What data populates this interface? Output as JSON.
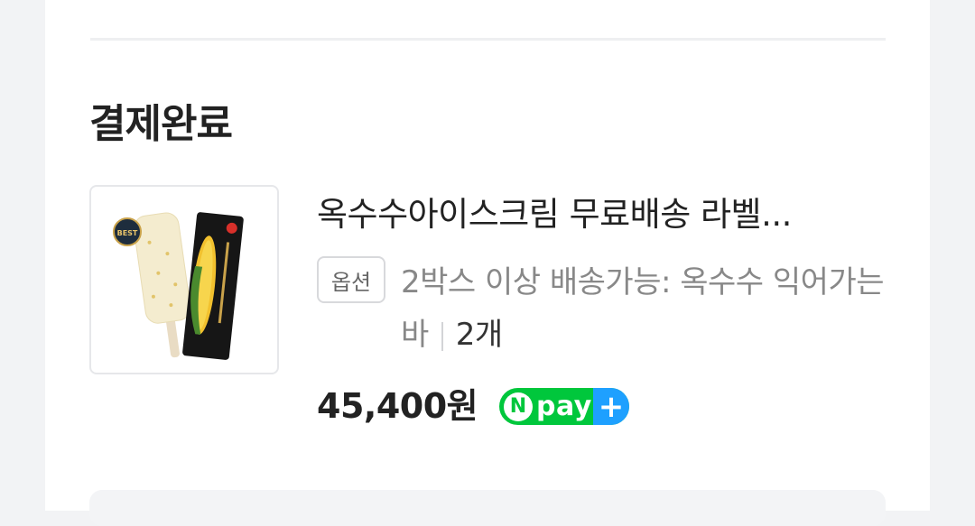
{
  "section": {
    "title": "결제완료"
  },
  "product": {
    "name": "옥수수아이스크림 무료배송 라벨...",
    "option_badge": "옵션",
    "option_text": "2박스 이상 배송가능: 옥수수 익어가는 바",
    "quantity": "2개",
    "price": "45,400원",
    "image_badge": "BEST",
    "npay_label": "pay",
    "npay_n": "N",
    "npay_plus": "+"
  },
  "colors": {
    "npay_green": "#00c73c",
    "npay_blue": "#1ea0ff"
  },
  "icons": {
    "npay": "npay-plus-icon"
  }
}
